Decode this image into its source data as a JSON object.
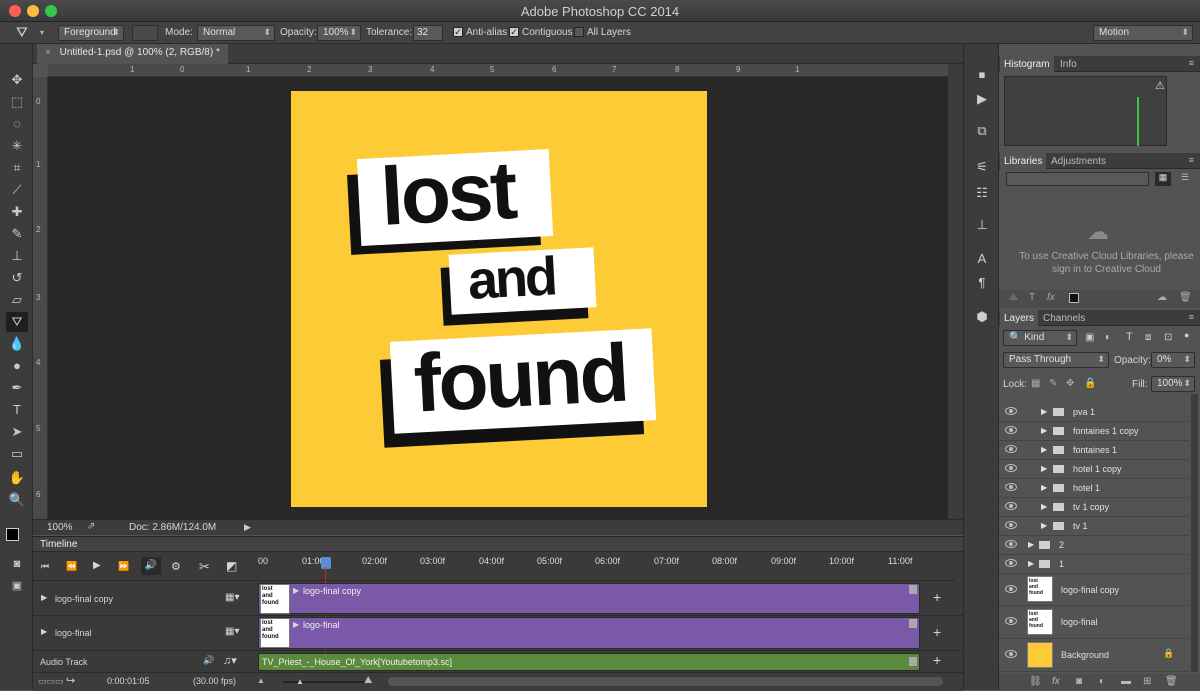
{
  "app": {
    "title": "Adobe Photoshop CC 2014"
  },
  "options_bar": {
    "fill_source": "Foreground",
    "mode_label": "Mode:",
    "mode_value": "Normal",
    "opacity_label": "Opacity:",
    "opacity_value": "100%",
    "tolerance_label": "Tolerance:",
    "tolerance_value": "32",
    "antialias_label": "Anti-alias",
    "contiguous_label": "Contiguous",
    "all_layers_label": "All Layers",
    "workspace": "Motion"
  },
  "document": {
    "tab_title": "Untitled-1.psd @ 100% (2, RGB/8) *",
    "zoom": "100%",
    "doc_size": "Doc: 2.86M/124.0M",
    "hruler_ticks": [
      "1",
      "0",
      "1",
      "2",
      "3",
      "4",
      "5",
      "6",
      "7",
      "8",
      "9",
      "1"
    ],
    "vruler_ticks": [
      "0",
      "1",
      "2",
      "3",
      "4",
      "5",
      "6"
    ],
    "artwork": {
      "word1": "lost",
      "word2": "and",
      "word3": "found",
      "bg_color": "#fdcb35"
    }
  },
  "timeline": {
    "title": "Timeline",
    "timecode": "0:00:01:05",
    "fps": "(30.00 fps)",
    "ruler": [
      "00",
      "01:00",
      "02:00f",
      "03:00f",
      "04:00f",
      "05:00f",
      "06:00f",
      "07:00f",
      "08:00f",
      "09:00f",
      "10:00f",
      "11:00f"
    ],
    "tracks": [
      {
        "name": "logo-final copy",
        "clip": "logo-final copy"
      },
      {
        "name": "logo-final",
        "clip": "logo-final"
      }
    ],
    "audio_track": {
      "name": "Audio Track",
      "clip": "TV_Priest_-_House_Of_York[Youtubetomp3.sc]"
    }
  },
  "panels": {
    "histogram_tab": "Histogram",
    "info_tab": "Info",
    "libraries_tab": "Libraries",
    "adjustments_tab": "Adjustments",
    "libraries_message": "To use Creative Cloud Libraries, please sign in to Creative Cloud",
    "layers_tab": "Layers",
    "channels_tab": "Channels",
    "kind_filter": "Kind",
    "blend_mode": "Pass Through",
    "opacity_label": "Opacity:",
    "opacity_value": "0%",
    "lock_label": "Lock:",
    "fill_label": "Fill:",
    "fill_value": "100%",
    "layers": [
      "pva 1",
      "fontaines 1 copy",
      "fontaines 1",
      "hotel 1 copy",
      "hotel 1",
      "tv 1 copy",
      "tv 1"
    ],
    "groups": [
      "2",
      "1"
    ],
    "image_layers": [
      "logo-final copy",
      "logo-final"
    ],
    "background_layer": "Background"
  }
}
